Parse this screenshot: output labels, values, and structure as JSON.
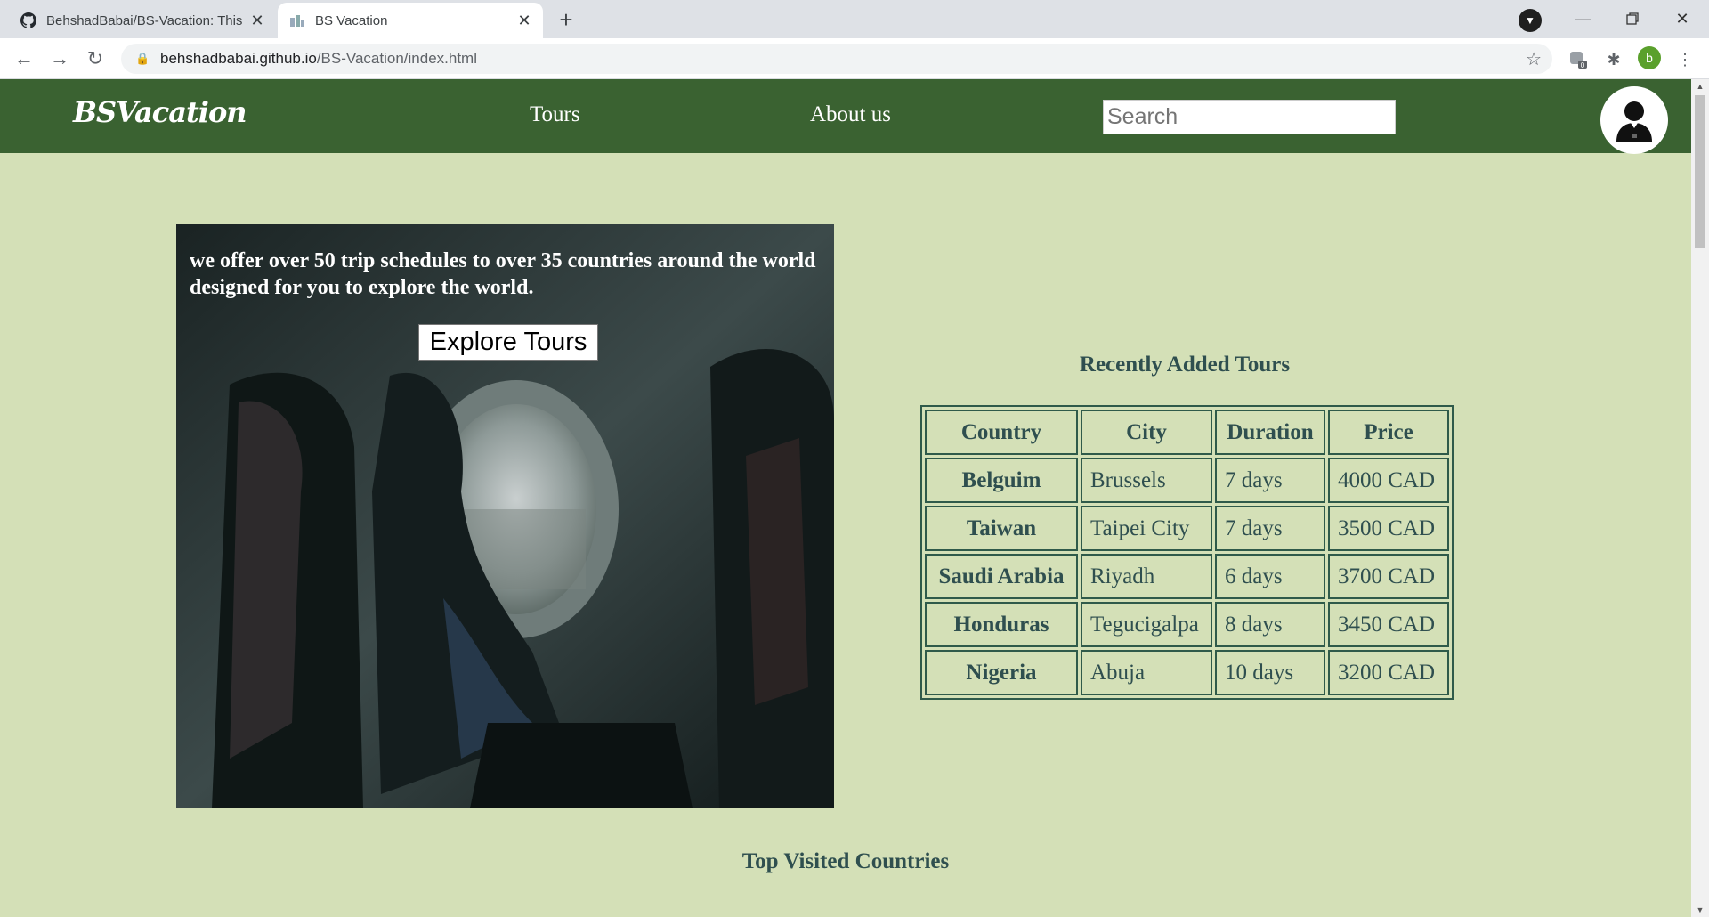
{
  "browser": {
    "tabs": [
      {
        "title": "BehshadBabai/BS-Vacation: This ",
        "close": "✕"
      },
      {
        "title": "BS Vacation",
        "close": "✕"
      }
    ],
    "new_tab": "+",
    "url_host": "behshadbabai.github.io",
    "url_path": "/BS-Vacation/index.html",
    "profile_initial": "b",
    "extension_badge": "0"
  },
  "site": {
    "logo": "BSVacation",
    "nav": {
      "tours": "Tours",
      "about": "About us"
    },
    "search_placeholder": "Search"
  },
  "hero": {
    "text": "we offer over 50 trip schedules to over 35 countries around the world designed for you to explore the world.",
    "button": "Explore Tours"
  },
  "recent": {
    "title": "Recently Added Tours",
    "headers": [
      "Country",
      "City",
      "Duration",
      "Price"
    ],
    "rows": [
      [
        "Belguim",
        "Brussels",
        "7 days",
        "4000 CAD"
      ],
      [
        "Taiwan",
        "Taipei City",
        "7 days",
        "3500 CAD"
      ],
      [
        "Saudi Arabia",
        "Riyadh",
        "6 days",
        "3700 CAD"
      ],
      [
        "Honduras",
        "Tegucigalpa",
        "8 days",
        "3450 CAD"
      ],
      [
        "Nigeria",
        "Abuja",
        "10 days",
        "3200 CAD"
      ]
    ]
  },
  "top_visited_title": "Top Visited Countries"
}
